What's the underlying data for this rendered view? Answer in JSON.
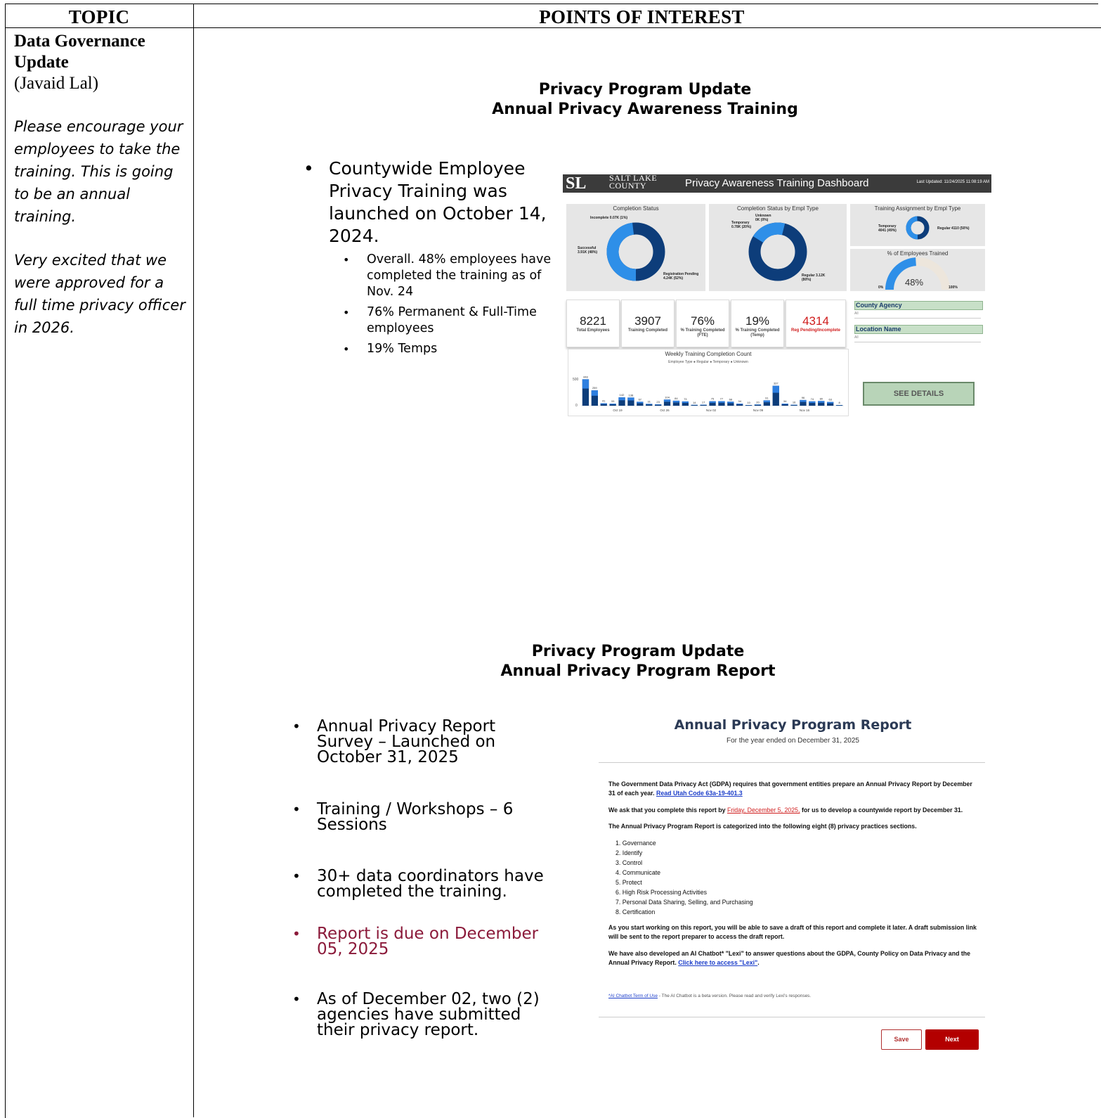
{
  "table": {
    "topic_header": "TOPIC",
    "poi_header": "POINTS OF INTEREST"
  },
  "topic": {
    "title_line1": "Data Governance",
    "title_line2": "Update",
    "presenter": "(Javaid Lal)",
    "note1": "Please encourage your employees to take the training. This is going to be an annual training.",
    "note2": "Very excited that we were approved for a full time privacy officer in 2026."
  },
  "slide1": {
    "title_line1": "Privacy Program Update",
    "title_line2": "Annual Privacy Awareness Training",
    "bullet_main": "Countywide Employee Privacy Training was launched on October 14, 2024.",
    "sub_bullets": [
      "Overall. 48% employees have completed the training as of Nov. 24",
      "76% Permanent & Full-Time employees",
      "19% Temps"
    ]
  },
  "dashboard": {
    "logo_text": "SL",
    "county_text": "SALT LAKE COUNTY",
    "title": "Privacy Awareness Training Dashboard",
    "last_updated": "Last Updated: 11/24/2025 11:08:19 AM",
    "panels": {
      "completion_status": "Completion Status",
      "by_empl_type": "Completion Status by Empl Type",
      "assignment": "Training Assignment by Empl Type",
      "pct_trained": "% of Employees Trained",
      "weekly": "Weekly Training Completion Count"
    },
    "donut_labels": {
      "incomplete": "Incomplete 0.07K (1%)",
      "successful": "Successful 3.91K (48%)",
      "reg_pending": "Registration Pending 4.24K (52%)",
      "unknown": "Unknown 0K (0%)",
      "temporary": "Temporary 0.78K (20%)",
      "regular": "Regular 3.12K (80%)",
      "assign_temp": "Temporary 4041 (49%)",
      "assign_reg": "Regular 4110 (50%)"
    },
    "gauge": {
      "value": "48%",
      "min": "0%",
      "max": "100%",
      "fraction": 0.48
    },
    "kpis": [
      {
        "value": "8221",
        "label": "Total Employees",
        "color": "#222222"
      },
      {
        "value": "3907",
        "label": "Training Completed",
        "color": "#222222"
      },
      {
        "value": "76%",
        "label": "% Training Completed (FTE)",
        "color": "#222222"
      },
      {
        "value": "19%",
        "label": "% Training Completed (Temp)",
        "color": "#222222"
      },
      {
        "value": "4314",
        "label": "Reg Pending/Incomplete",
        "color": "#d01c1c"
      }
    ],
    "filters": [
      {
        "label": "County Agency",
        "value": "All"
      },
      {
        "label": "Location Name",
        "value": "All"
      }
    ],
    "legend": "Employee Type  ● Regular  ● Temporary  ● Unknown",
    "see_details": "SEE DETAILS"
  },
  "chart_data": {
    "type": "bar",
    "title": "Weekly Training Completion Count",
    "legend": [
      "Regular",
      "Temporary",
      "Unknown"
    ],
    "categories": [
      "Oct 19",
      "Oct 26",
      "Nov 02",
      "Nov 09",
      "Nov 16"
    ],
    "y_ticks": [
      "500",
      "0"
    ],
    "values": [
      448,
      259,
      41,
      33,
      142,
      138,
      67,
      31,
      23,
      104,
      84,
      73,
      14,
      17,
      75,
      77,
      68,
      34,
      10,
      20,
      91,
      337,
      34,
      16,
      96,
      74,
      80,
      63,
      8
    ],
    "ylim": [
      0,
      500
    ],
    "colors": {
      "regular": "#0d3d7a",
      "temporary": "#2e7fe0",
      "unknown": "#111111"
    }
  },
  "slide2": {
    "title_line1": "Privacy Program Update",
    "title_line2": "Annual Privacy Program Report",
    "bullets": [
      "Annual Privacy Report Survey – Launched on October 31, 2025",
      "Training / Workshops – 6 Sessions",
      "30+ data coordinators have completed the training.",
      "Report is due on December 05, 2025",
      "As of December 02, two (2) agencies have submitted their privacy report."
    ]
  },
  "report": {
    "title": "Annual Privacy Program Report",
    "subtitle": "For the year ended on December 31, 2025",
    "p1": "The Government Data Privacy Act (GDPA) requires that government entities prepare an Annual Privacy Report by December 31 of each year.",
    "p1_link": "Read Utah Code 63a-19-401.3",
    "p2_pre": "We ask that you complete this report by",
    "p2_date": "Friday, December 5, 2025,",
    "p2_post": "for us to develop a countywide report by December 31.",
    "p3": "The Annual Privacy Program Report is categorized into the following eight (8) privacy practices sections.",
    "sections": [
      "1. Governance",
      "2. Identify",
      "3. Control",
      "4. Communicate",
      "5. Protect",
      "6. High Risk Processing Activities",
      "7. Personal Data Sharing, Selling, and Purchasing",
      "8. Certification"
    ],
    "p4": "As you start working on this report, you will be able to save a draft of this report and complete it later. A draft submission link will be sent to the report preparer to access the draft report.",
    "p5": "We have also developed an AI Chatbot* \"Lexi\" to answer questions about the GDPA, County Policy on Data Privacy and the Annual Privacy Report.",
    "p5_link": "Click here to access \"Lexi\"",
    "p5_end": ".",
    "foot_link": "*AI Chatbot Term of Use",
    "foot_text": " - The AI Chatbot is a beta version. Please read and verify Lexi's responses.",
    "save": "Save",
    "next": "Next"
  }
}
